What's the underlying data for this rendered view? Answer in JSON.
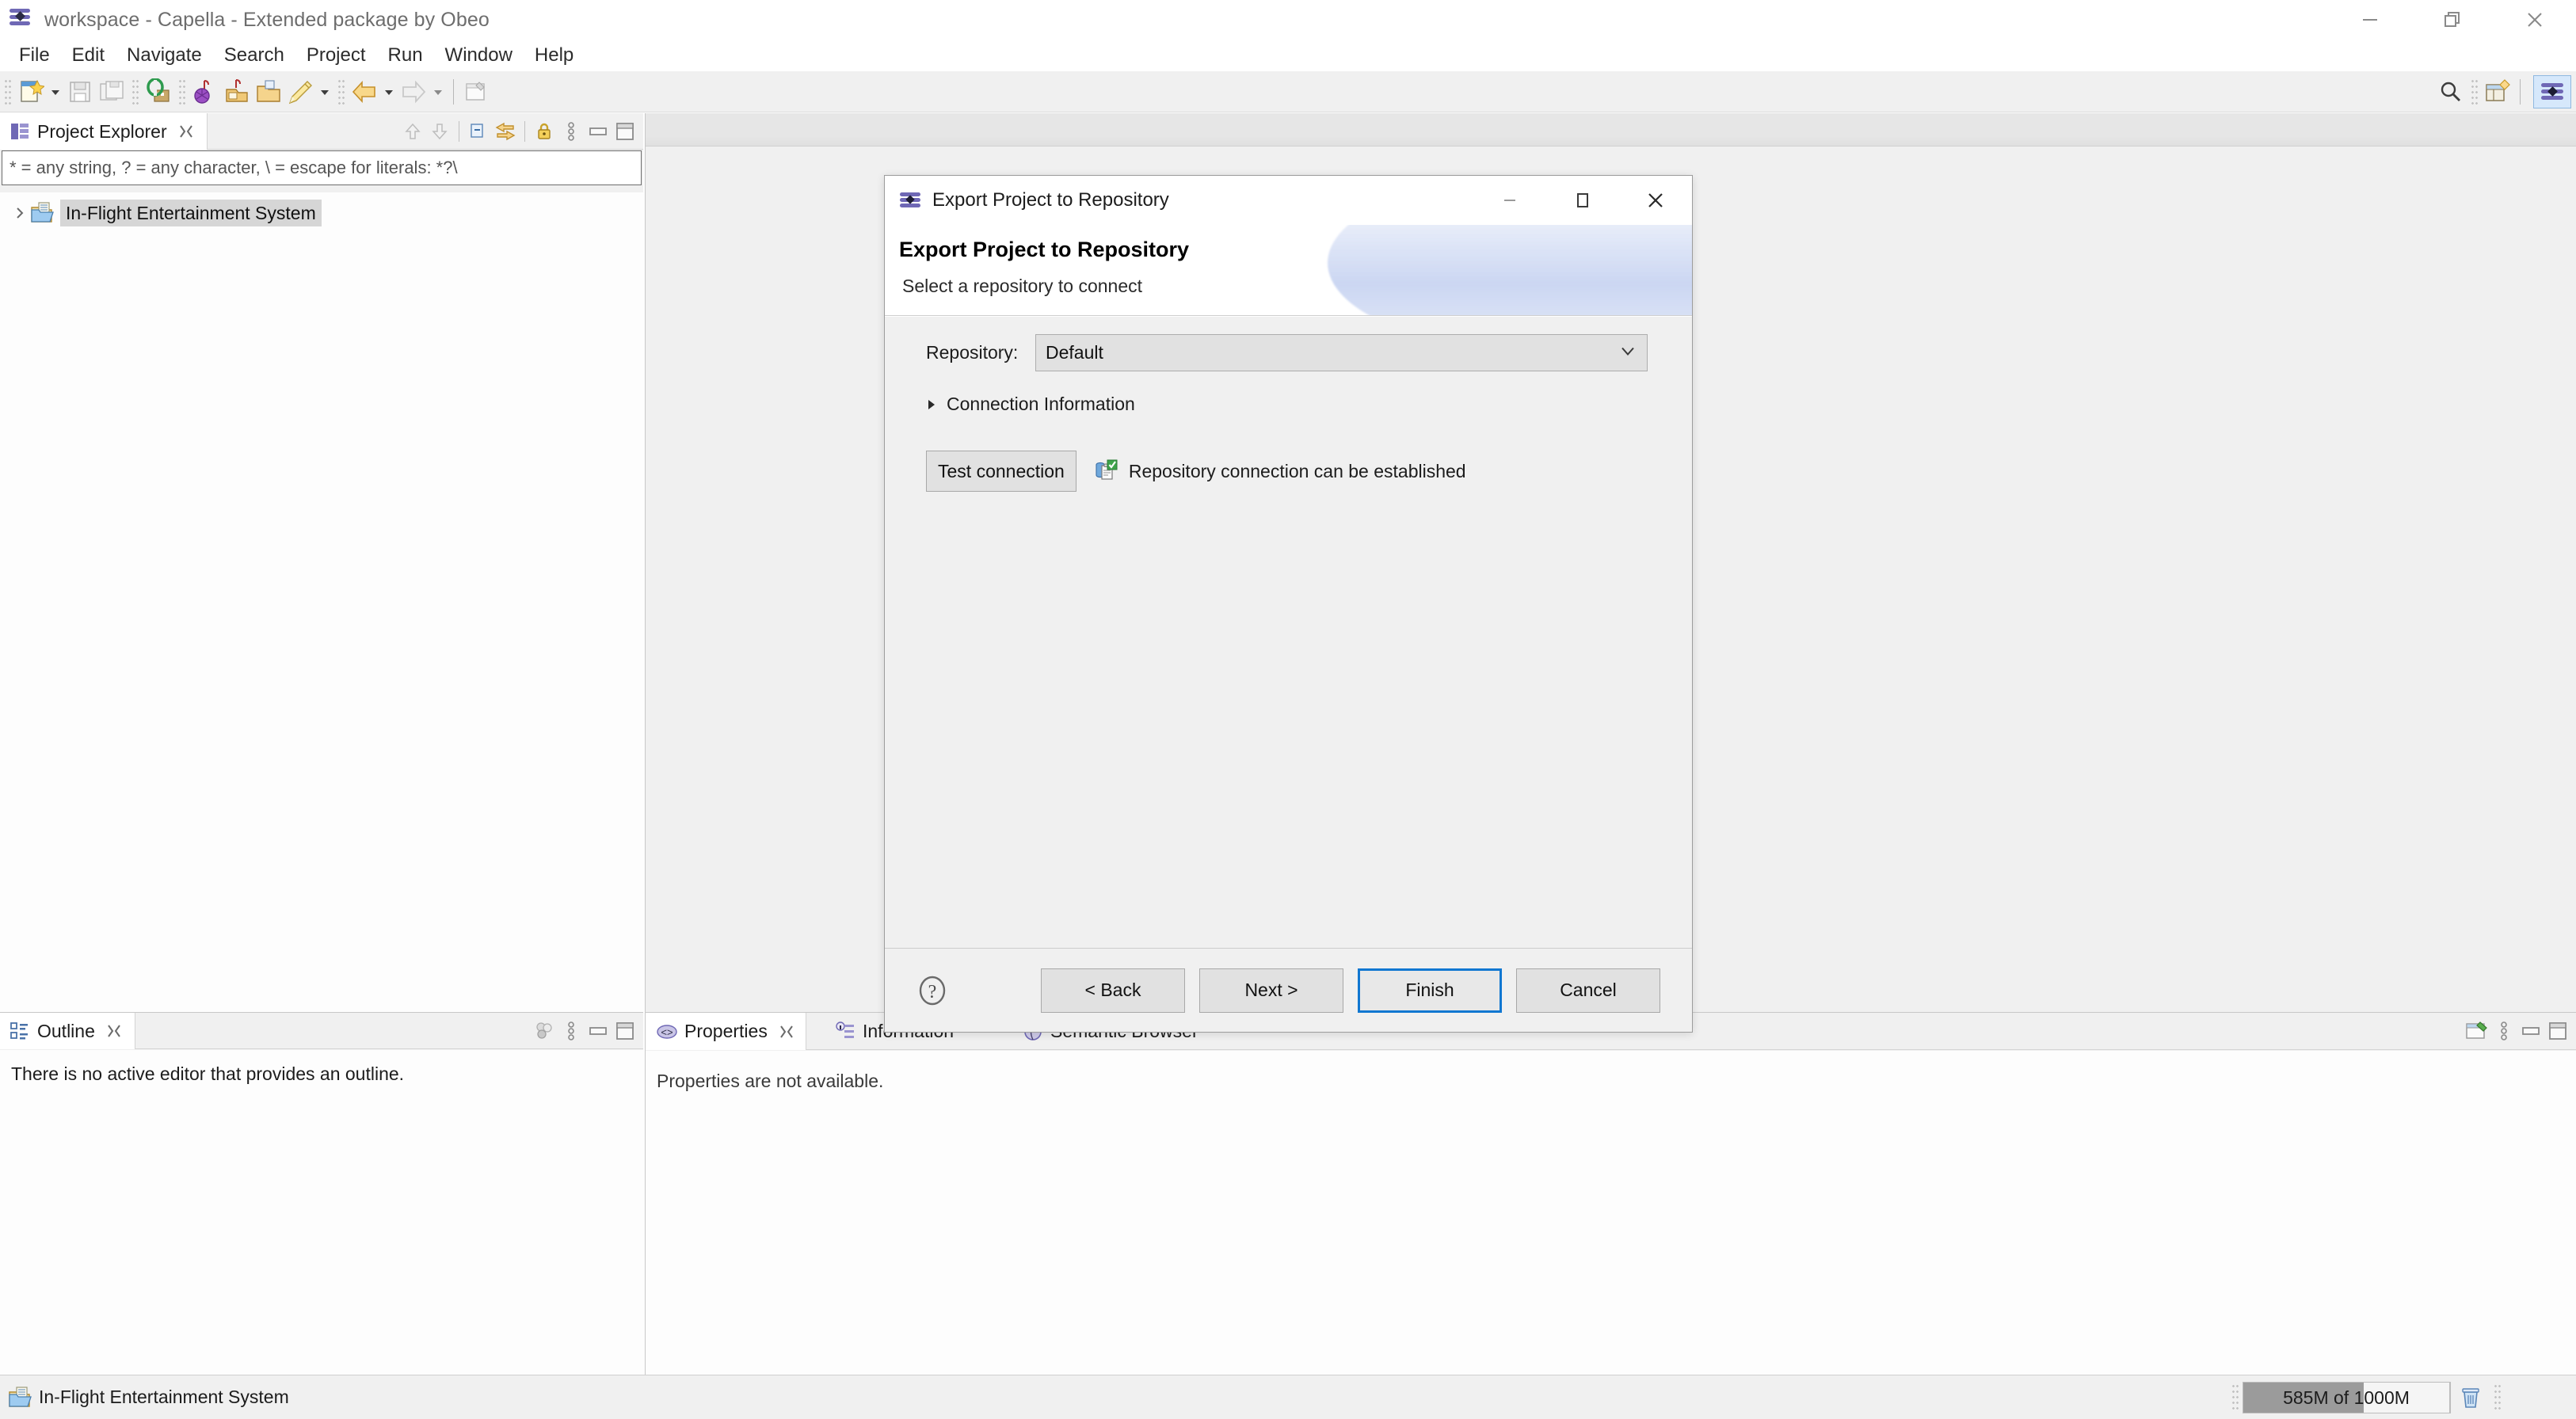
{
  "window": {
    "title": "workspace - Capella - Extended package by Obeo",
    "app_icon": "capella-logo-icon",
    "controls": [
      {
        "name": "minimize-button",
        "glyph": "minimize-icon"
      },
      {
        "name": "restore-button",
        "glyph": "restore-icon"
      },
      {
        "name": "close-button",
        "glyph": "close-icon"
      }
    ]
  },
  "menubar": {
    "items": [
      {
        "label": "File"
      },
      {
        "label": "Edit"
      },
      {
        "label": "Navigate"
      },
      {
        "label": "Search"
      },
      {
        "label": "Project"
      },
      {
        "label": "Run"
      },
      {
        "label": "Window"
      },
      {
        "label": "Help"
      }
    ]
  },
  "toolbar": {
    "items": [
      {
        "name": "new-wizard-button",
        "icon": "new-file-icon"
      },
      {
        "name": "new-dropdown",
        "icon": "chevron-down-icon"
      },
      {
        "name": "save-button",
        "icon": "save-icon"
      },
      {
        "name": "save-all-button",
        "icon": "save-all-icon"
      },
      {
        "name": "validate-model-button",
        "icon": "validate-icon"
      },
      {
        "name": "transition-button",
        "icon": "transition-icon"
      },
      {
        "name": "import-button",
        "icon": "import-icon"
      },
      {
        "name": "export-button",
        "icon": "export-folder-icon"
      },
      {
        "name": "diagram-tool-button",
        "icon": "pencil-icon"
      },
      {
        "name": "diagram-dropdown",
        "icon": "chevron-down-icon"
      },
      {
        "name": "back-button",
        "icon": "arrow-left-icon"
      },
      {
        "name": "back-dropdown",
        "icon": "chevron-down-icon"
      },
      {
        "name": "forward-button",
        "icon": "arrow-right-icon"
      },
      {
        "name": "forward-dropdown",
        "icon": "chevron-down-icon"
      },
      {
        "name": "open-editor-button",
        "icon": "editor-icon"
      }
    ],
    "right_items": [
      {
        "name": "search-button",
        "icon": "search-icon"
      },
      {
        "name": "open-perspective-button",
        "icon": "perspective-add-icon"
      },
      {
        "name": "capella-perspective-button",
        "icon": "capella-logo-icon",
        "active": true
      }
    ]
  },
  "project_explorer": {
    "tab_label": "Project Explorer",
    "tab_icon": "project-explorer-icon",
    "filter_text": "* = any string, ? = any character, \\ = escape for literals: *?\\",
    "toolbar": [
      {
        "name": "collapse-up-button",
        "icon": "arrow-up-icon"
      },
      {
        "name": "expand-down-button",
        "icon": "arrow-down-icon"
      },
      {
        "name": "collapse-all-button",
        "icon": "collapse-all-icon"
      },
      {
        "name": "link-with-editor-button",
        "icon": "link-editor-icon"
      },
      {
        "name": "lock-button",
        "icon": "lock-icon"
      },
      {
        "name": "view-menu-button",
        "icon": "view-menu-icon"
      },
      {
        "name": "minimize-view-button",
        "icon": "minimize-view-icon"
      },
      {
        "name": "maximize-view-button",
        "icon": "maximize-view-icon"
      }
    ],
    "tree": [
      {
        "label": "In-Flight Entertainment System",
        "icon": "capella-project-icon",
        "expanded": false,
        "selected": true
      }
    ]
  },
  "outline": {
    "tab_label": "Outline",
    "tab_icon": "outline-icon",
    "message": "There is no active editor that provides an outline.",
    "toolbar": [
      {
        "name": "outline-filter-button",
        "icon": "filter-dots-icon"
      },
      {
        "name": "view-menu-button",
        "icon": "view-menu-icon"
      },
      {
        "name": "minimize-view-button",
        "icon": "minimize-view-icon"
      },
      {
        "name": "maximize-view-button",
        "icon": "maximize-view-icon"
      }
    ]
  },
  "properties_panel": {
    "tabs": [
      {
        "label": "Properties",
        "icon": "properties-icon",
        "active": true,
        "closable": true
      },
      {
        "label": "Information",
        "icon": "information-icon",
        "active": false,
        "closable": false
      },
      {
        "label": "Semantic Browser",
        "icon": "semantic-browser-icon",
        "active": false,
        "closable": false
      }
    ],
    "message": "Properties are not available.",
    "toolbar": [
      {
        "name": "pin-editor-button",
        "icon": "pin-editor-icon"
      },
      {
        "name": "view-menu-button",
        "icon": "view-menu-icon"
      },
      {
        "name": "minimize-view-button",
        "icon": "minimize-view-icon"
      },
      {
        "name": "maximize-view-button",
        "icon": "maximize-view-icon"
      }
    ]
  },
  "statusbar": {
    "selection_label": "In-Flight Entertainment System",
    "selection_icon": "capella-project-icon",
    "heap": {
      "label": "585M of 1000M",
      "used_mb": 585,
      "total_mb": 1000,
      "percent": 58.5,
      "trash_icon": "trash-icon"
    }
  },
  "dialog": {
    "window_title": "Export Project to Repository",
    "window_icon": "capella-logo-icon",
    "controls": [
      {
        "name": "dialog-minimize-button",
        "glyph": "minimize-icon"
      },
      {
        "name": "dialog-maximize-button",
        "glyph": "maximize-icon"
      },
      {
        "name": "dialog-close-button",
        "glyph": "close-icon"
      }
    ],
    "header_title": "Export Project to Repository",
    "header_subtitle": "Select a repository to connect",
    "repository": {
      "label": "Repository:",
      "value": "Default",
      "options": [
        "Default"
      ]
    },
    "connection_information": {
      "label": "Connection Information",
      "expanded": false
    },
    "test_connection": {
      "button_label": "Test connection",
      "status_icon": "repository-ok-icon",
      "status_message": "Repository connection can be established"
    },
    "footer": {
      "help_icon": "help-icon",
      "buttons": [
        {
          "label": "< Back",
          "name": "back-button",
          "default": false
        },
        {
          "label": "Next >",
          "name": "next-button",
          "default": false
        },
        {
          "label": "Finish",
          "name": "finish-button",
          "default": true
        },
        {
          "label": "Cancel",
          "name": "cancel-button",
          "default": false
        }
      ]
    }
  },
  "colors": {
    "accent_blue": "#1177d1",
    "capella_purple": "#6f68b5",
    "panel_bg": "#f0f0f0",
    "selection_gray": "#d6d6d6",
    "heap_fill": "#9b9b9b"
  }
}
